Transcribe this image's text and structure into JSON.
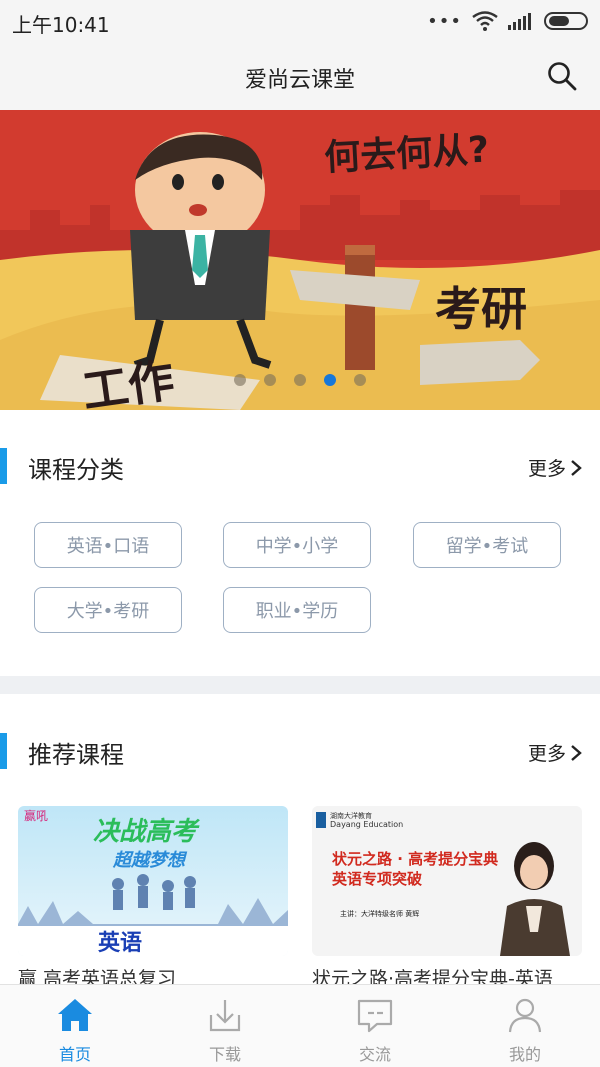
{
  "status_bar": {
    "time": "上午10:41",
    "dots": "•••"
  },
  "header": {
    "title": "爱尚云课堂"
  },
  "banner": {
    "headline": "何去何从?",
    "sign_right": "考研",
    "sign_left": "工作",
    "active_slide": 4,
    "slide_count": 5
  },
  "categories": {
    "title": "课程分类",
    "more": "更多",
    "items": [
      "英语•口语",
      "中学•小学",
      "留学•考试",
      "大学•考研",
      "职业•学历"
    ]
  },
  "recommended": {
    "title": "推荐课程",
    "more": "更多",
    "courses": [
      {
        "title": "赢 高考英语总复习",
        "thumb_badge": "赢吼",
        "thumb_headline_1": "决战高考",
        "thumb_headline_2": "超越梦想",
        "thumb_subject": "英语"
      },
      {
        "title": "状元之路·高考提分宝典-英语",
        "thumb_brand_cn": "湖南大洋教育",
        "thumb_brand_en": "Dayang Education",
        "thumb_headline_1": "状元之路 · 高考提分宝典",
        "thumb_headline_2": "英语专项突破",
        "thumb_speaker": "主讲：大洋特级名师  黄辉"
      }
    ]
  },
  "bottom_nav": {
    "items": [
      {
        "label": "首页",
        "icon": "home-icon",
        "active": true
      },
      {
        "label": "下载",
        "icon": "download-icon",
        "active": false
      },
      {
        "label": "交流",
        "icon": "chat-icon",
        "active": false
      },
      {
        "label": "我的",
        "icon": "user-icon",
        "active": false
      }
    ]
  },
  "colors": {
    "accent": "#1a9be8",
    "nav_active": "#1a8be0",
    "tag_border": "#9fb0c4",
    "banner_red": "#d23b2f",
    "banner_sand": "#f1c75a"
  }
}
